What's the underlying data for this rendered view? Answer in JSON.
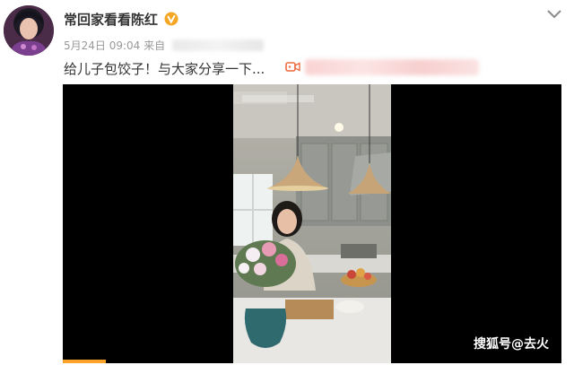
{
  "post": {
    "username": "常回家看看陈红",
    "date": "5月24日 09:04",
    "source_prefix": "来自",
    "text": "给儿子包饺子！与大家分享一下...",
    "verified_color": "#f5a623",
    "link_icon": "video-camera-icon"
  },
  "video": {
    "watermark": "搜狐号@去火",
    "progress_color": "#ffa32b"
  }
}
